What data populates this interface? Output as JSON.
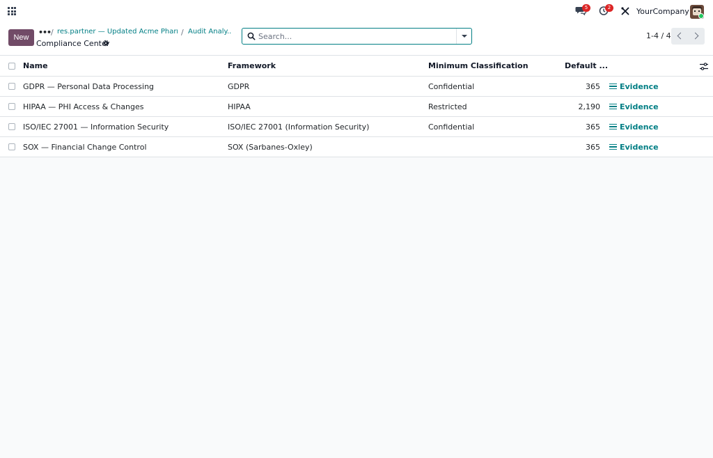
{
  "navbar": {
    "apps_icon": "grid-icon",
    "messages_count": "5",
    "activities_count": "2",
    "company_name": "YourCompany"
  },
  "control": {
    "new_label": "New",
    "breadcrumbs": [
      {
        "label": "res.partner — Updated Acme Pharm..."
      },
      {
        "label": "Audit Analy..."
      }
    ],
    "page_title": "Compliance Center",
    "search_placeholder": "Search...",
    "pager": "1-4 / 4"
  },
  "table": {
    "columns": [
      "Name",
      "Framework",
      "Minimum Classification",
      "Default ..."
    ],
    "rows": [
      {
        "name": "GDPR — Personal Data Processing",
        "framework": "GDPR",
        "min_class": "Confidential",
        "default": "365",
        "action": "Evidence"
      },
      {
        "name": "HIPAA — PHI Access & Changes",
        "framework": "HIPAA",
        "min_class": "Restricted",
        "default": "2,190",
        "action": "Evidence"
      },
      {
        "name": "ISO/IEC 27001 — Information Security",
        "framework": "ISO/IEC 27001 (Information Security)",
        "min_class": "Confidential",
        "default": "365",
        "action": "Evidence"
      },
      {
        "name": "SOX — Financial Change Control",
        "framework": "SOX (Sarbanes-Oxley)",
        "min_class": "",
        "default": "365",
        "action": "Evidence"
      }
    ]
  },
  "colors": {
    "brand": "#714b67",
    "link": "#017e84",
    "badge": "#dc2626"
  }
}
